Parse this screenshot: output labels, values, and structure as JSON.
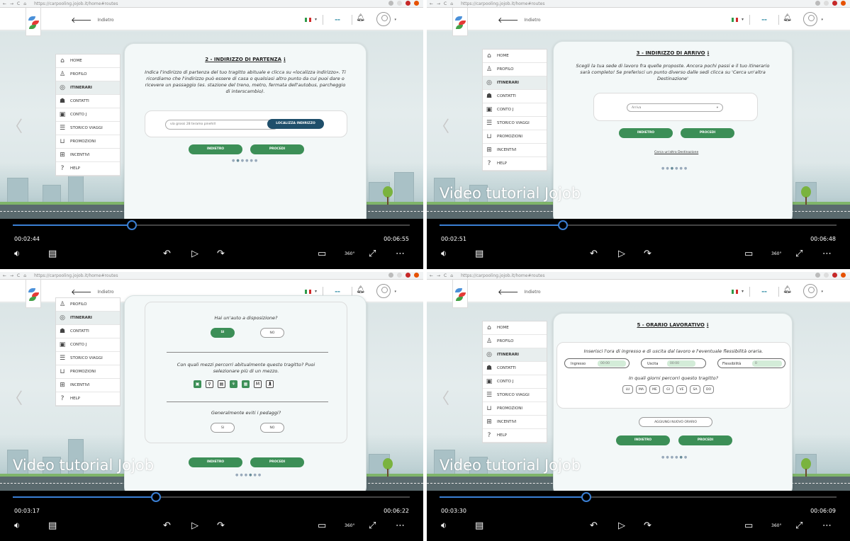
{
  "browser": {
    "url": "https://carpooling.jojob.it/home#routes"
  },
  "app": {
    "back_label": "Indietro",
    "lang_dropdown": "▾"
  },
  "sidebar": {
    "home": "HOME",
    "profilo": "PROFILO",
    "itinerari": "ITINERARI",
    "contatti": "CONTATTI",
    "conto": "CONTO J",
    "storico": "STORICO VIAGGI",
    "promozioni": "PROMOZIONI",
    "incentivi": "INCENTIVI",
    "help": "HELP"
  },
  "video_title": "Video tutorial Jojob",
  "panels": [
    {
      "step_title": "2 - INDIRIZZO DI PARTENZA",
      "description": "Indica l'indirizzo di partenza del tuo tragitto abituale e clicca su «localizza indirizzo». Ti ricordiamo che l'indirizzo può essere di casa o qualsiasi altro punto da cui puoi dare o ricevere un passaggio (es. stazione del treno, metro, fermata dell'autobus, parcheggio di interscambio).",
      "address_value": "via grossi 28 teramo pinehill",
      "localize_button": "LOCALIZZA INDIRIZZO",
      "back_button": "INDIETRO",
      "next_button": "PROCEDI",
      "time_elapsed": "00:02:44",
      "time_total": "00:06:55",
      "progress": 0.3
    },
    {
      "step_title": "3 - INDIRIZZO DI ARRIVO",
      "description": "Scegli la tua sede di lavoro fra quelle proposte. Ancora pochi passi e il tuo itinerario sarà completo! Se preferisci un punto diverso dalle sedi clicca su 'Cerca un'altra Destinazione'",
      "select_value": "Arriva",
      "back_button": "INDIETRO",
      "next_button": "PROCEDI",
      "link": "Cerca un'altra Destinazione",
      "time_elapsed": "00:02:51",
      "time_total": "00:06:48",
      "progress": 0.31
    },
    {
      "car_question": "Hai un'auto a disposizione?",
      "yes": "SI",
      "no": "NO",
      "mezzi_question": "Con quali mezzi percorri abitualmente questo tragitto? Puoi selezionare più di un mezzo.",
      "toll_question": "Generalmente eviti i pedaggi?",
      "back_button": "INDIETRO",
      "next_button": "PROCEDI",
      "time_elapsed": "00:03:17",
      "time_total": "00:06:22",
      "progress": 0.36
    },
    {
      "step_title": "5 - ORARIO LAVORATIVO",
      "description": "Inserisci l'ora di ingresso e di uscita dal lavoro e l'eventuale flessibilità oraria.",
      "ingresso_label": "Ingresso",
      "ingresso_value": "00:00",
      "uscita_label": "Uscita",
      "uscita_value": "00:00",
      "flex_label": "Flessibilità",
      "flex_value": "0",
      "days_question": "In quali giorni percorri questo tragitto?",
      "days": [
        "LU",
        "MA",
        "ME",
        "GI",
        "VE",
        "SA",
        "DO"
      ],
      "add_button": "AGGIUNGI NUOVO ORARIO",
      "back_button": "INDIETRO",
      "next_button": "PROCEDI",
      "time_elapsed": "00:03:30",
      "time_total": "00:06:09",
      "progress": 0.37
    }
  ],
  "colors": {
    "accent_green": "#3c8f57",
    "dark_button": "#1f4f6b",
    "progress_blue": "#3a7fd4"
  }
}
